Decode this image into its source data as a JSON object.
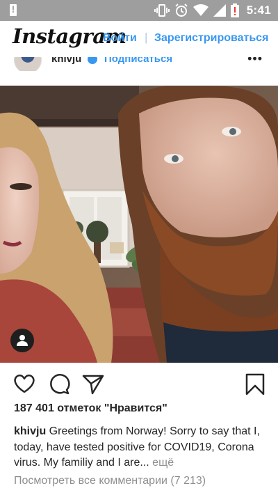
{
  "status_bar": {
    "time": "5:41",
    "icons": [
      "alert-icon",
      "vibrate-icon",
      "alarm-icon",
      "wifi-icon",
      "signal-icon",
      "battery-alert-icon"
    ]
  },
  "header": {
    "logo_text": "Instagram",
    "login_label": "Войти",
    "separator": "|",
    "signup_label": "Зарегистрироваться"
  },
  "post": {
    "username": "khivju",
    "follow_label": "Подписаться",
    "separator_dot": "•",
    "more_label": "•••",
    "likes_text": "187 401 отметок \"Нравится\"",
    "caption": {
      "username": "khivju",
      "text": " Greetings from Norway! Sorry to say that I, today, have tested positive for COVID19, Corona virus. My familiy and I are...",
      "more_label": " ещё"
    },
    "view_comments": "Посмотреть все комментарии (7 213)"
  },
  "colors": {
    "status_bar": "#9e9e9e",
    "link_blue": "#3897f0",
    "text": "#262626",
    "muted": "#8e8e8e"
  }
}
